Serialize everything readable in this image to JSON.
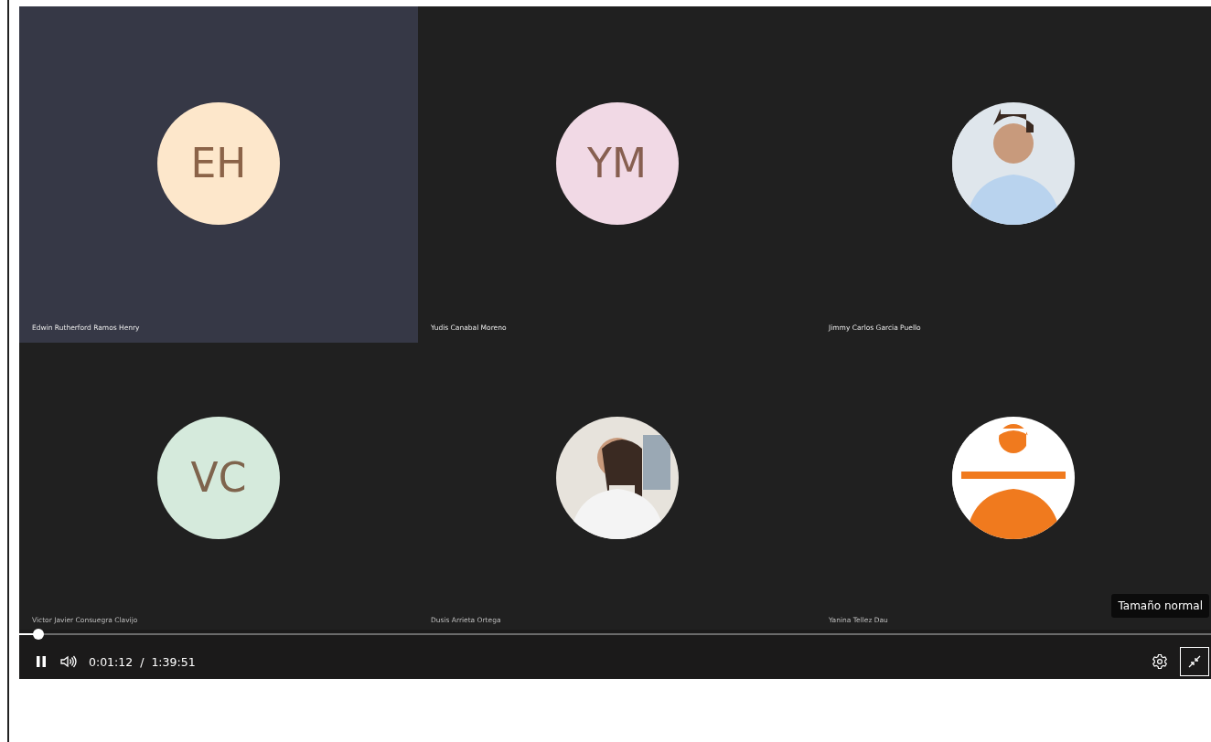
{
  "tiles": [
    {
      "name": "Edwin Rutherford Ramos Henry",
      "highlighted": true,
      "avatar": {
        "kind": "initials",
        "initials": "EH",
        "color": "#fde7cb"
      }
    },
    {
      "name": "Yudis Canabal Moreno",
      "highlighted": false,
      "avatar": {
        "kind": "initials",
        "initials": "YM",
        "color": "#f1d9e5"
      }
    },
    {
      "name": "Jimmy Carlos Garcia Puello",
      "highlighted": false
    },
    {
      "name": "Victor Javier Consuegra Clavijo",
      "highlighted": false,
      "avatar": {
        "kind": "initials",
        "initials": "VC",
        "color": "#d5eadc"
      }
    },
    {
      "name": "Dusis Arrieta Ortega",
      "highlighted": false
    },
    {
      "name": "Yanina Tellez Dau",
      "highlighted": false
    }
  ],
  "player": {
    "level": 0.016,
    "playing": true,
    "current_time": "0:01:12",
    "separator": "/",
    "duration": "1:39:51",
    "tooltip": "Tamaño normal"
  }
}
